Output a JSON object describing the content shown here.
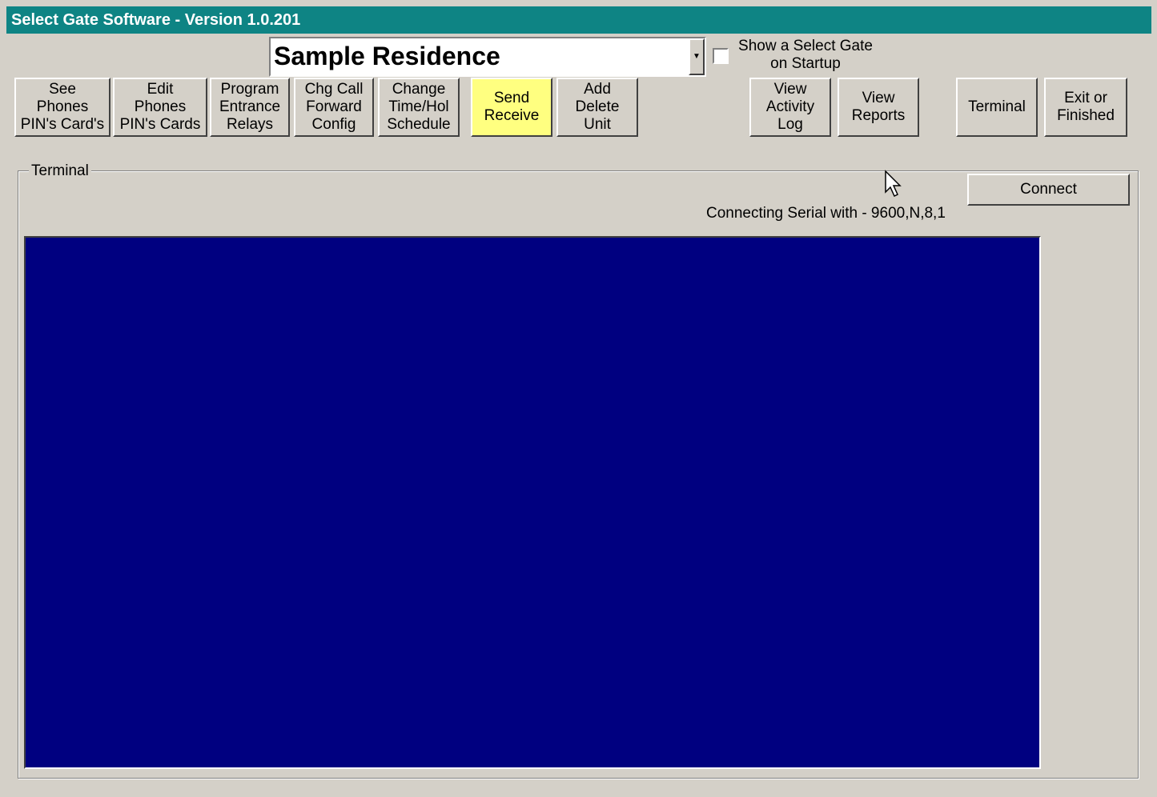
{
  "title": "Select Gate Software - Version 1.0.201",
  "site_selector": {
    "value": "Sample Residence"
  },
  "startup_checkbox": {
    "label": "Show a Select Gate\non Startup",
    "checked": false
  },
  "toolbar": [
    {
      "label": "See\nPhones\nPIN's Card's"
    },
    {
      "label": "Edit\nPhones\nPIN's Cards"
    },
    {
      "label": "Program\nEntrance\nRelays"
    },
    {
      "label": "Chg Call\nForward\nConfig"
    },
    {
      "label": "Change\nTime/Hol\nSchedule"
    },
    {
      "label": "Send\nReceive"
    },
    {
      "label": "Add\nDelete\nUnit"
    },
    {
      "label": "View\nActivity\nLog"
    },
    {
      "label": "View\nReports"
    },
    {
      "label": "Terminal"
    },
    {
      "label": "Exit or\nFinished"
    }
  ],
  "terminal_group": {
    "legend": "Terminal",
    "connect_label": "Connect",
    "status": "Connecting Serial with - 9600,N,8,1"
  },
  "colors": {
    "titlebar": "#0e8484",
    "terminal_bg": "#000080",
    "active_button": "#ffff80"
  }
}
